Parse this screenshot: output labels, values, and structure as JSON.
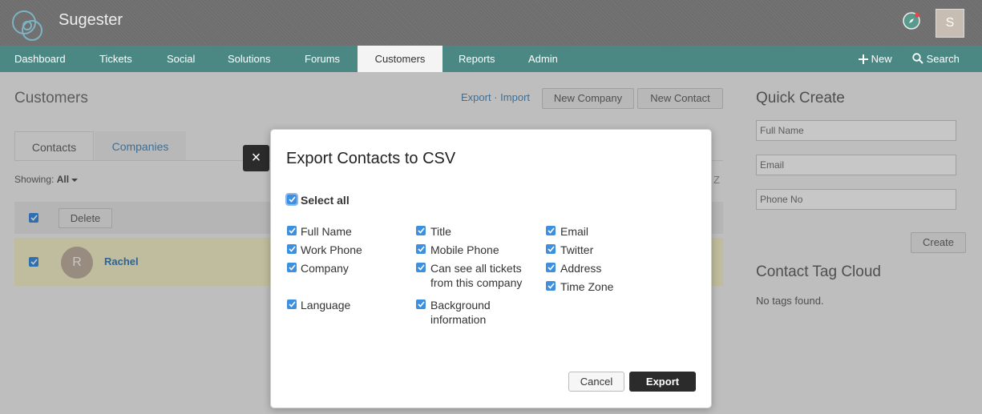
{
  "app": {
    "brand": "Sugester",
    "avatar_initial": "S"
  },
  "nav": {
    "items": [
      "Dashboard",
      "Tickets",
      "Social",
      "Solutions",
      "Forums",
      "Customers",
      "Reports",
      "Admin"
    ],
    "active": "Customers",
    "new_label": "New",
    "search_label": "Search"
  },
  "page": {
    "title": "Customers",
    "export_link": "Export",
    "separator": "·",
    "import_link": "Import",
    "new_company": "New Company",
    "new_contact": "New Contact",
    "tabs": [
      "Contacts",
      "Companies"
    ],
    "showing_label": "Showing:",
    "showing_value": "All",
    "delete_button": "Delete",
    "alpha_letter": "Z",
    "row": {
      "avatar_initial": "R",
      "name": "Rachel"
    }
  },
  "sidebar": {
    "quick_create_title": "Quick Create",
    "full_name_placeholder": "Full Name",
    "email_placeholder": "Email",
    "phone_placeholder": "Phone No",
    "create_button": "Create",
    "tag_cloud_title": "Contact Tag Cloud",
    "no_tags": "No tags found."
  },
  "modal": {
    "close_symbol": "×",
    "title": "Export Contacts to CSV",
    "select_all": "Select all",
    "fields": {
      "full_name": "Full Name",
      "work_phone": "Work Phone",
      "company": "Company",
      "language": "Language",
      "title": "Title",
      "mobile_phone": "Mobile Phone",
      "can_see_1": "Can see all tickets",
      "can_see_2": "from this company",
      "background_1": "Background",
      "background_2": "information",
      "email": "Email",
      "twitter": "Twitter",
      "address": "Address",
      "time_zone": "Time Zone"
    },
    "cancel": "Cancel",
    "export": "Export"
  },
  "colors": {
    "nav_bg": "#4b8884",
    "topbar_bg": "#6e6e6e",
    "checkbox": "#3d8fe0",
    "link": "#4a90c8",
    "export_btn": "#2b2b2b"
  }
}
